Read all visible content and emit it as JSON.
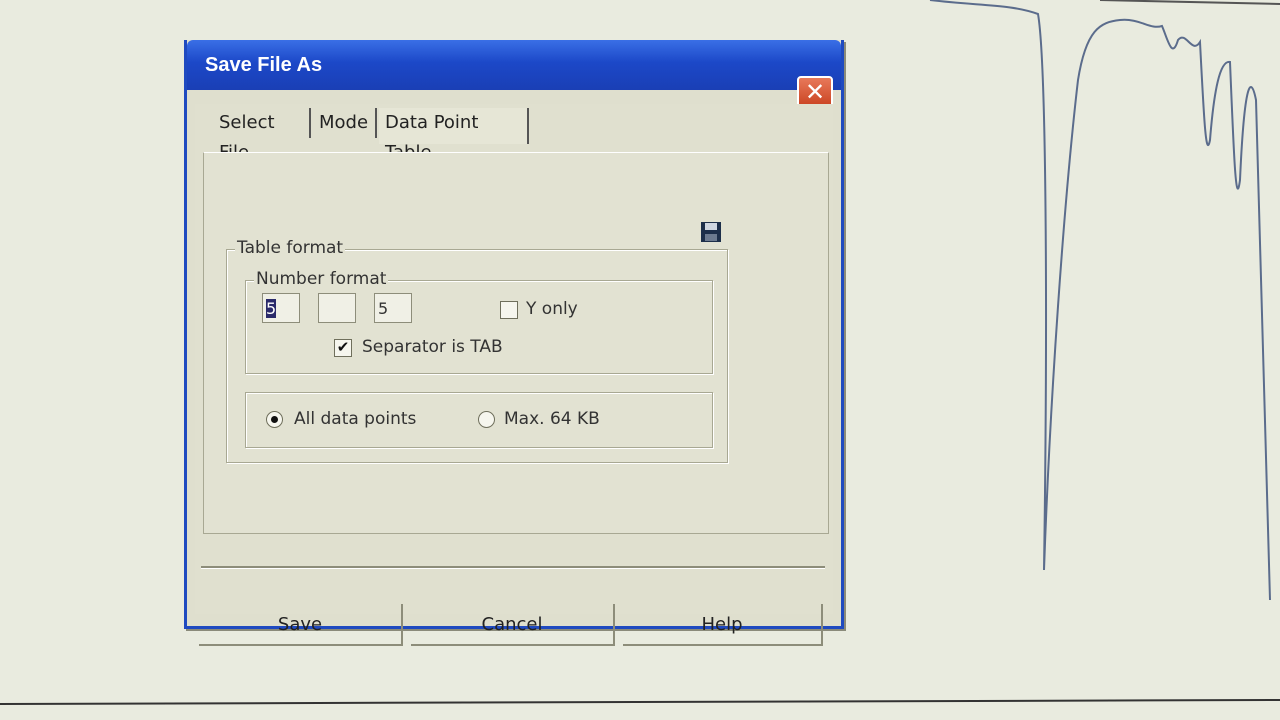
{
  "dialog": {
    "title": "Save File As",
    "close_glyph": "✕"
  },
  "tabs": [
    {
      "label": "Select File"
    },
    {
      "label": "Mode"
    },
    {
      "label": "Data Point Table",
      "active": true
    }
  ],
  "table_format": {
    "label": "Table format",
    "number_format": {
      "label": "Number format",
      "field1": "5",
      "field2": "",
      "field3": "5",
      "y_only_label": "Y only",
      "y_only_checked": false,
      "separator_label": "Separator is TAB",
      "separator_checked": true
    },
    "all_points_label": "All data points",
    "max_label": "Max. 64 KB",
    "selected": "all"
  },
  "buttons": {
    "save": "Save",
    "cancel": "Cancel",
    "help": "Help"
  },
  "icons": {
    "save_icon": "floppy-disk-icon"
  },
  "colors": {
    "titlebar": "#1c48c8",
    "dialog_bg": "#dfdfce",
    "plot_line": "#5b6c8c"
  }
}
